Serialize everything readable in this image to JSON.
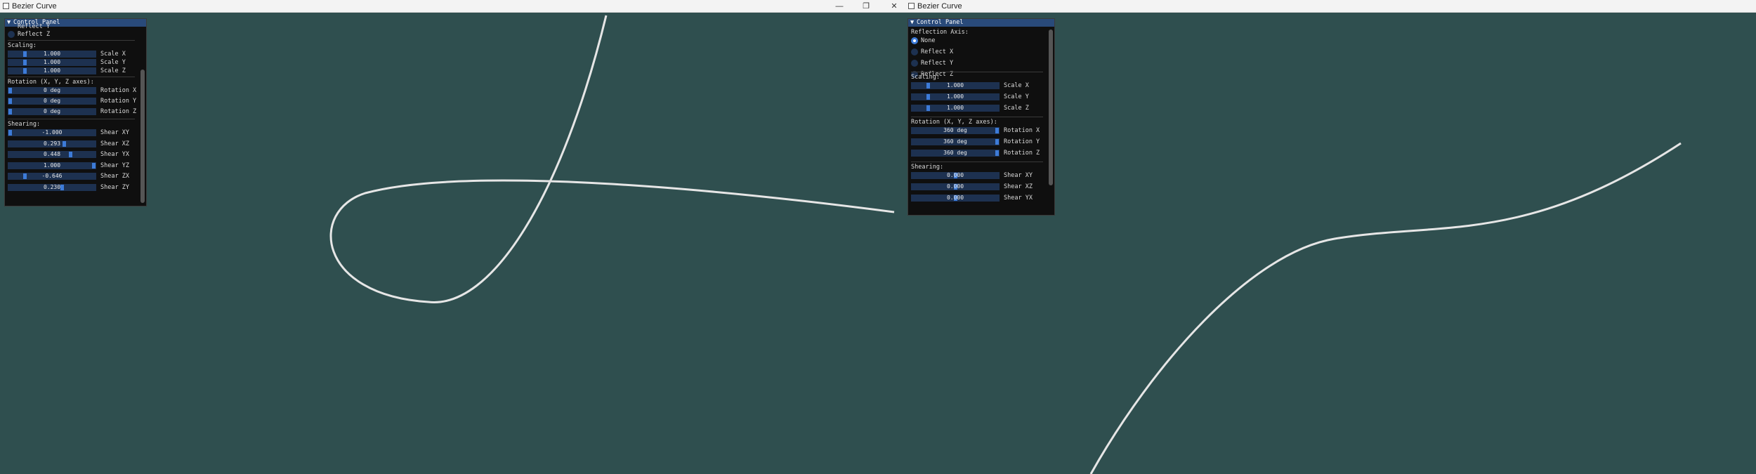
{
  "left_window": {
    "title": "Bezier Curve",
    "controls": [
      "—",
      "❐",
      "✕"
    ],
    "panel": {
      "header": "Control Panel",
      "clipped_label": "Reflect Y",
      "reflect_z": "Reflect Z",
      "scaling_title": "Scaling:",
      "scaling": [
        {
          "value": "1.000",
          "label": "Scale X",
          "fraction": 0.18
        },
        {
          "value": "1.000",
          "label": "Scale Y",
          "fraction": 0.18
        },
        {
          "value": "1.000",
          "label": "Scale Z",
          "fraction": 0.18
        }
      ],
      "rotation_title": "Rotation (X, Y, Z axes):",
      "rotation": [
        {
          "value": "0 deg",
          "label": "Rotation X",
          "fraction": 0.0
        },
        {
          "value": "0 deg",
          "label": "Rotation Y",
          "fraction": 0.0
        },
        {
          "value": "0 deg",
          "label": "Rotation Z",
          "fraction": 0.0
        }
      ],
      "shearing_title": "Shearing:",
      "shearing": [
        {
          "value": "-1.000",
          "label": "Shear XY",
          "fraction": 0.0
        },
        {
          "value": "0.293",
          "label": "Shear XZ",
          "fraction": 0.65
        },
        {
          "value": "0.448",
          "label": "Shear YX",
          "fraction": 0.72
        },
        {
          "value": "1.000",
          "label": "Shear YZ",
          "fraction": 1.0
        },
        {
          "value": "-0.646",
          "label": "Shear ZX",
          "fraction": 0.18
        },
        {
          "value": "0.230",
          "label": "Shear ZY",
          "fraction": 0.62
        }
      ]
    }
  },
  "right_window": {
    "title": "Bezier Curve",
    "panel": {
      "header": "Control Panel",
      "reflection_title": "Reflection Axis:",
      "reflection_options": [
        {
          "label": "None",
          "selected": true
        },
        {
          "label": "Reflect X",
          "selected": false
        },
        {
          "label": "Reflect Y",
          "selected": false
        },
        {
          "label": "Reflect Z",
          "selected": false
        }
      ],
      "scaling_title": "Scaling:",
      "scaling": [
        {
          "value": "1.000",
          "label": "Scale X",
          "fraction": 0.18
        },
        {
          "value": "1.000",
          "label": "Scale Y",
          "fraction": 0.18
        },
        {
          "value": "1.000",
          "label": "Scale Z",
          "fraction": 0.18
        }
      ],
      "rotation_title": "Rotation (X, Y, Z axes):",
      "rotation": [
        {
          "value": "360 deg",
          "label": "Rotation X",
          "fraction": 1.0
        },
        {
          "value": "360 deg",
          "label": "Rotation Y",
          "fraction": 1.0
        },
        {
          "value": "360 deg",
          "label": "Rotation Z",
          "fraction": 1.0
        }
      ],
      "shearing_title": "Shearing:",
      "shearing": [
        {
          "value": "0.000",
          "label": "Shear XY",
          "fraction": 0.5
        },
        {
          "value": "0.000",
          "label": "Shear XZ",
          "fraction": 0.5
        },
        {
          "value": "0.000",
          "label": "Shear YX",
          "fraction": 0.5
        }
      ]
    }
  },
  "colors": {
    "background": "#2f4f4f",
    "curve": "#e6e6e6",
    "panel_bg": "#0f0f0f",
    "header_bg": "#294a7a",
    "slider_bg": "#1d3150",
    "slider_grab": "#3d7bd8"
  }
}
